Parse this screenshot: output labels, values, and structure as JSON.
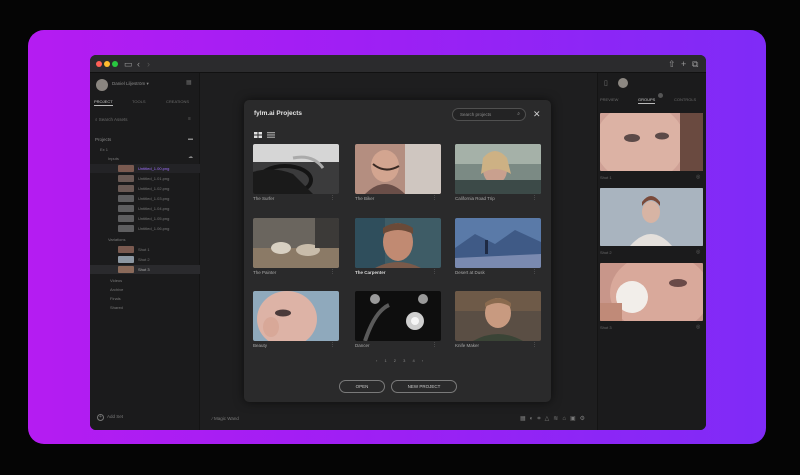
{
  "app": {
    "user_name": "Daniel Liljeström ▾"
  },
  "sidebar": {
    "tabs": [
      "PROJECT",
      "TOOLS",
      "CREATIONS"
    ],
    "search_placeholder": "Search Assets",
    "section_label": "Projects",
    "tree": [
      {
        "label": "Ex 1"
      },
      {
        "label": "Inputs"
      },
      {
        "label": "Untitled_1.00.png"
      },
      {
        "label": "Untitled_1.01.png"
      },
      {
        "label": "Untitled_1.02.png"
      },
      {
        "label": "Untitled_1.03.png"
      },
      {
        "label": "Untitled_1.04.png"
      },
      {
        "label": "Untitled_1.05.png"
      },
      {
        "label": "Untitled_1.06.png"
      },
      {
        "label": "Variations"
      },
      {
        "label": "Shot 1"
      },
      {
        "label": "Shot 2"
      },
      {
        "label": "Shot 3"
      },
      {
        "label": "Videos"
      },
      {
        "label": "Archive"
      },
      {
        "label": "Finals"
      },
      {
        "label": "Shared"
      }
    ],
    "add_label": "Add Set"
  },
  "bottom": {
    "tool_label": "Magic Wand"
  },
  "right_panel": {
    "tabs": [
      "PREVIEW",
      "GROUPS",
      "CONTROLS"
    ],
    "captions": [
      "Shot 1",
      "Shot 2",
      "Shot 3"
    ]
  },
  "modal": {
    "title": "fylm.ai Projects",
    "search_placeholder": "Search projects",
    "close_glyph": "✕",
    "projects": [
      {
        "name": "The Surfer",
        "bold": false
      },
      {
        "name": "The Biker",
        "bold": false
      },
      {
        "name": "California Road Trip",
        "bold": false
      },
      {
        "name": "The Painter",
        "bold": false
      },
      {
        "name": "The Carpenter",
        "bold": true
      },
      {
        "name": "Desert at Dusk",
        "bold": false
      },
      {
        "name": "Beauty",
        "bold": false
      },
      {
        "name": "Dancer",
        "bold": false
      },
      {
        "name": "Knife Maker",
        "bold": false
      }
    ],
    "pagination": "‹ 1 2 3 4 ›",
    "open_label": "OPEN",
    "new_project_label": "NEW PROJECT"
  },
  "colors": {
    "accent": "#a020f0",
    "glow_start": "#b51cf2",
    "glow_end": "#7f2bf7"
  }
}
